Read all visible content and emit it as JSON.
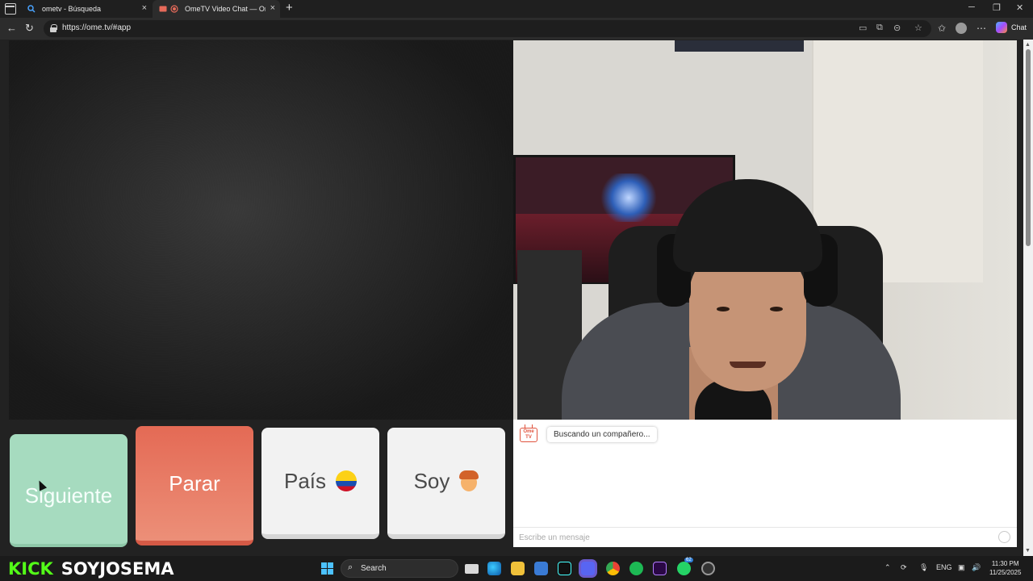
{
  "browser": {
    "tabs": [
      {
        "title": "ometv - Búsqueda",
        "favicon": "search-icon"
      },
      {
        "title": "OmeTV Video Chat — Omegle Alternative",
        "favicon": "recording-icon",
        "active": true
      }
    ],
    "url": "https://ome.tv/#app",
    "copilot_label": "Chat"
  },
  "controls": {
    "next_label": "Siguiente",
    "stop_label": "Parar",
    "country_label": "País",
    "gender_label": "Soy"
  },
  "chat": {
    "logo_text": "Ome TV",
    "status": "Buscando un compañero...",
    "input_placeholder": "Escribe un mensaje"
  },
  "overlay": {
    "brand_kick": "KICK",
    "brand_user": "SOYJOSEMA"
  },
  "taskbar": {
    "search_label": "Search",
    "language": "ENG",
    "time": "11:30 PM",
    "date": "11/25/2025",
    "badge_count": "62"
  },
  "colors": {
    "next": "#a6dbbf",
    "stop": "#e46a55",
    "kick_green": "#53fc18",
    "ome_red": "#e0533d"
  }
}
